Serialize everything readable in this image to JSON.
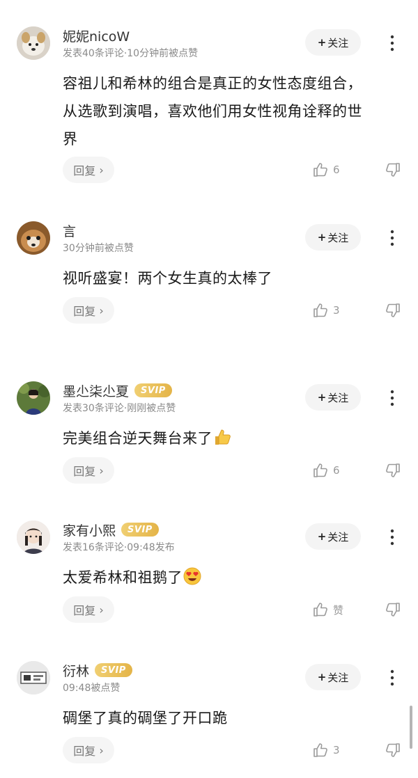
{
  "follow_label": "关注",
  "reply_label": "回复",
  "comments": [
    {
      "name": "妮妮nicoW",
      "svip": "",
      "meta": "发表40条评论·10分钟前被点赞",
      "lines": [
        "容祖儿和希林的组合是真正的女性态度组合，",
        "从选歌到演唱，喜欢他们用女性视角诠释的世",
        "界"
      ],
      "likes": "6"
    },
    {
      "name": "言",
      "svip": "",
      "meta": "30分钟前被点赞",
      "lines": [
        "视听盛宴！两个女生真的太棒了"
      ],
      "likes": "3"
    },
    {
      "name": "墨尐柒尐夏",
      "svip": "SVIP",
      "meta": "发表30条评论·刚刚被点赞",
      "lines": [
        "完美组合逆天舞台来了"
      ],
      "emoji": "thumbs-up",
      "likes": "6"
    },
    {
      "name": "家有小熙",
      "svip": "SVIP",
      "meta": "发表16条评论·09:48发布",
      "lines": [
        "太爱希林和祖鹅了"
      ],
      "emoji": "heart-eyes",
      "likes": "赞"
    },
    {
      "name": "衍林",
      "svip": "SVIP",
      "meta": "09:48被点赞",
      "lines": [
        "碉堡了真的碉堡了开口跪"
      ],
      "likes": "3"
    }
  ]
}
